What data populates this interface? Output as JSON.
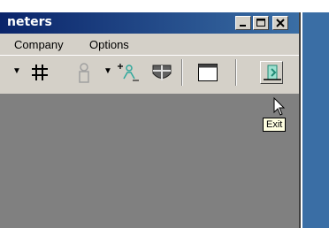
{
  "window": {
    "title": "neters"
  },
  "menu": {
    "items": [
      "Company",
      "Options"
    ]
  },
  "toolbar": {
    "buttons": [
      "grid-icon",
      "person-icon",
      "add-person-icon",
      "building-icon",
      "window-icon",
      "exit-icon"
    ]
  },
  "tooltip": {
    "text": "Exit"
  },
  "colors": {
    "titlebar": "#0a246a",
    "face": "#d4d0c8",
    "client": "#808080",
    "desktop": "#3a6ea5"
  }
}
